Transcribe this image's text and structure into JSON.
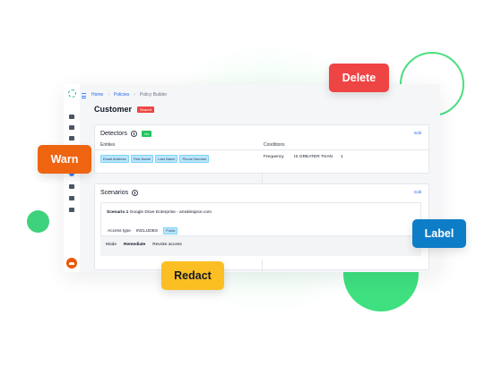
{
  "breadcrumb": {
    "items": [
      "Home",
      "Policies",
      "Policy Builder"
    ]
  },
  "page": {
    "title": "Customer",
    "status_badge": "Shared"
  },
  "detectors": {
    "title": "Detectors",
    "status_badge": "On",
    "edit_label": "Edit",
    "columns": [
      "Entities",
      "Conditions"
    ],
    "entities": [
      "Email Address",
      "First Name",
      "Last Name",
      "Phone Number"
    ],
    "condition": {
      "field": "Frequency",
      "operator": "IS GREATER THAN",
      "value": "1"
    }
  },
  "scenarios": {
    "title": "Scenarios",
    "edit_label": "Edit",
    "scenario": {
      "label": "Scenario 1",
      "name": "Google Drive Enterprise - arrakisspice.com",
      "access_label": "Access type",
      "access_operator": "INCLUDES",
      "access_value": "Public",
      "mode_label": "Mode",
      "mode_value": "Remediate",
      "mode_action": "Revoke access"
    }
  },
  "actions": {
    "delete": "Delete",
    "warn": "Warn",
    "label": "Label",
    "redact": "Redact"
  },
  "colors": {
    "delete": "#ef4444",
    "warn": "#ee6411",
    "label": "#0e7dc8",
    "redact": "#fbbf24",
    "accent_green": "#3ee07f"
  },
  "icons": {
    "sidebar": [
      "logo-icon",
      "home-icon",
      "grid-icon",
      "layers-icon",
      "shield-icon",
      "settings-icon",
      "database-icon",
      "chart-icon"
    ]
  }
}
